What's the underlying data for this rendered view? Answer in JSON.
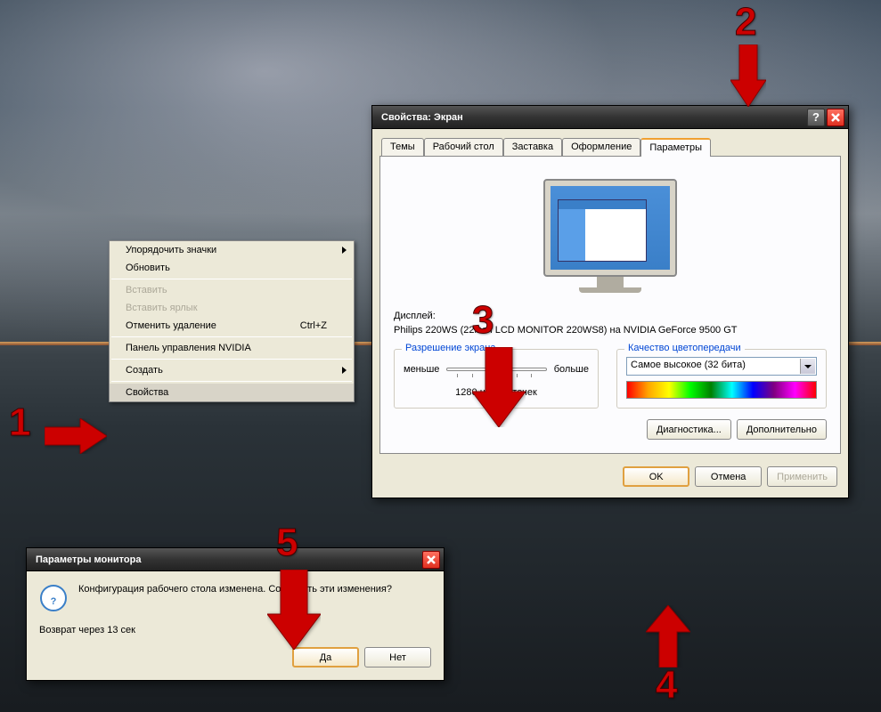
{
  "context_menu": {
    "arrange_icons": "Упорядочить значки",
    "refresh": "Обновить",
    "paste": "Вставить",
    "paste_shortcut": "Вставить ярлык",
    "undo_delete": "Отменить удаление",
    "undo_hotkey": "Ctrl+Z",
    "nvidia_panel": "Панель управления NVIDIA",
    "create": "Создать",
    "properties": "Свойства"
  },
  "display_dialog": {
    "title": "Свойства: Экран",
    "tabs": {
      "themes": "Темы",
      "desktop": "Рабочий стол",
      "screensaver": "Заставка",
      "appearance": "Оформление",
      "settings": "Параметры"
    },
    "display_label": "Дисплей:",
    "display_name": "Philips 220WS (22inch LCD MONITOR 220WS8) на NVIDIA GeForce 9500 GT",
    "resolution": {
      "legend": "Разрешение экрана",
      "less": "меньше",
      "more": "больше",
      "value": "1280 на 800 точек"
    },
    "color": {
      "legend": "Качество цветопередачи",
      "value": "Самое высокое (32 бита)"
    },
    "troubleshoot": "Диагностика...",
    "advanced": "Дополнительно",
    "ok": "OK",
    "cancel": "Отмена",
    "apply": "Применить"
  },
  "confirm_dialog": {
    "title": "Параметры монитора",
    "message": "Конфигурация рабочего стола изменена. Сохранить эти изменения?",
    "countdown": "Возврат через 13 сек",
    "yes": "Да",
    "no": "Нет"
  },
  "markers": {
    "m1": "1",
    "m2": "2",
    "m3": "3",
    "m4": "4",
    "m5": "5"
  }
}
